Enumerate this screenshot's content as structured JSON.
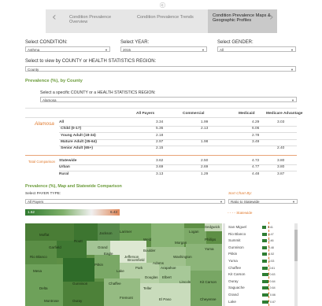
{
  "window": {
    "top_glyph": "ⓒ"
  },
  "tabs": [
    {
      "label": "Condition Prevalence Overview",
      "active": false
    },
    {
      "label": "Condition Prevalence Trends",
      "active": false
    },
    {
      "label": "Condition Prevalence Maps & Geographic Profiles",
      "active": true
    }
  ],
  "nav": {
    "prev": "‹",
    "next": "›"
  },
  "filters": {
    "condition_label": "Select CONDITION:",
    "condition_value": "Asthma",
    "year_label": "Select YEAR:",
    "year_value": "2015",
    "gender_label": "Select GENDER:",
    "gender_value": "All",
    "view_by_label": "Select to view by COUNTY or HEALTH STATISTICS REGION:",
    "view_by_value": "County"
  },
  "section1": {
    "title": "Prevalence (%), by County",
    "specific_label": "Select a specific COUNTY or a HEALTH STATISTICS REGION:",
    "specific_value": "Alamosa"
  },
  "table": {
    "columns": [
      "All Payers",
      "Commercial",
      "Medicaid",
      "Medicare Advantage"
    ],
    "group1_label": "Alamosa",
    "group1_rows": [
      {
        "label": "All",
        "values": [
          "3.34",
          "1.99",
          "4.29",
          "3.03"
        ]
      },
      {
        "label": "Child (0-17)",
        "values": [
          "5.36",
          "2.13",
          "6.06",
          ""
        ]
      },
      {
        "label": "Young Adult (18-34)",
        "values": [
          "2.18",
          "",
          "2.78",
          ""
        ]
      },
      {
        "label": "Mature Adult (35-64)",
        "values": [
          "2.97",
          "1.98",
          "3.49",
          ""
        ]
      },
      {
        "label": "Senior Adult (65+)",
        "values": [
          "2.15",
          "",
          "",
          "2.40"
        ]
      }
    ],
    "group2_label": "Total Comparison",
    "group2_rows": [
      {
        "label": "Statewide",
        "values": [
          "3.62",
          "2.50",
          "4.72",
          "3.80"
        ]
      },
      {
        "label": "Urban",
        "values": [
          "3.69",
          "2.69",
          "4.77",
          "3.80"
        ]
      },
      {
        "label": "Rural",
        "values": [
          "3.13",
          "1.29",
          "4.48",
          "3.87"
        ]
      }
    ]
  },
  "section2": {
    "title": "Prevalence (%), Map and Statewide Comparison",
    "payer_label": "Select PAYER TYPE:",
    "payer_value": "All Payers",
    "sort_label": "Sort Chart By:",
    "sort_value": "Ratio to Statewide",
    "legend_min": "1.52",
    "legend_max": "6.43",
    "statewide_legend": "Statewide",
    "legend_colors": {
      "low": "#2f7a2f",
      "high": "#e0885a"
    }
  },
  "map_labels": [
    "Moffat",
    "Routt",
    "Jackson",
    "Larimer",
    "Weld",
    "Logan",
    "Phillips",
    "Sedgwick",
    "Rio Blanco",
    "Grand",
    "Morgan",
    "Garfield",
    "Eagle",
    "Boulder",
    "Broomfield",
    "Adams",
    "Washington",
    "Yuma",
    "Mesa",
    "Pitkin",
    "Lake",
    "Park",
    "Jefferson",
    "Arapahoe",
    "Douglas",
    "Elbert",
    "Lincoln",
    "Kit Carson",
    "Delta",
    "Gunnison",
    "Chaffee",
    "Teller",
    "El Paso",
    "Cheyenne",
    "Montrose",
    "Fremont",
    "Ouray"
  ],
  "bar_list": [
    {
      "name": "San Miguel",
      "value": "0.41"
    },
    {
      "name": "Rio Blanco",
      "value": "0.47"
    },
    {
      "name": "Summit",
      "value": "0.46"
    },
    {
      "name": "Gunnison",
      "value": "0.48"
    },
    {
      "name": "Pitkin",
      "value": "0.52"
    },
    {
      "name": "Yuma",
      "value": "0.53"
    },
    {
      "name": "Chaffee",
      "value": "0.61"
    },
    {
      "name": "Kit Carson",
      "value": "0.63"
    },
    {
      "name": "Ouray",
      "value": "0.64"
    },
    {
      "name": "Saguache",
      "value": "0.64"
    },
    {
      "name": "Grand",
      "value": "0.66"
    },
    {
      "name": "Lake",
      "value": "0.67"
    }
  ]
}
